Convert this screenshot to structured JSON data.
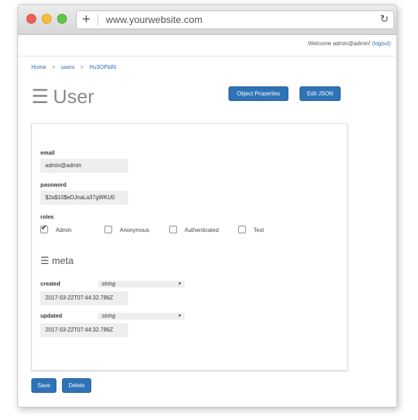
{
  "browser": {
    "url": "www.yourwebsite.com"
  },
  "header": {
    "welcome": "Welcome admin@admin!",
    "logout": "(logout)"
  },
  "breadcrumb": {
    "items": [
      "Home",
      "users",
      "Hu3OPtdN"
    ],
    "separator": ">"
  },
  "page": {
    "title": "User",
    "title_icon": "☰"
  },
  "toolbar": {
    "object_properties": "Object Properties",
    "edit_json": "Edit JSON"
  },
  "form": {
    "email": {
      "label": "email",
      "value": "admin@admin"
    },
    "password": {
      "label": "password",
      "value": "$2a$10$eDJnaLa37gWKU0"
    },
    "roles": {
      "label": "roles",
      "options": [
        {
          "label": "Admin",
          "checked": true
        },
        {
          "label": "Anonymous",
          "checked": false
        },
        {
          "label": "Authenticated",
          "checked": false
        },
        {
          "label": "Test",
          "checked": false
        }
      ]
    },
    "meta": {
      "title": "meta",
      "icon": "☰",
      "created": {
        "label": "created",
        "type": "string",
        "value": "2017-03-22T07:44:32.786Z"
      },
      "updated": {
        "label": "updated",
        "type": "string",
        "value": "2017-03-22T07:44:32.786Z"
      }
    }
  },
  "actions": {
    "save": "Save",
    "delete": "Delete"
  },
  "colors": {
    "accent": "#2f73b6",
    "link": "#2a6fb5"
  }
}
